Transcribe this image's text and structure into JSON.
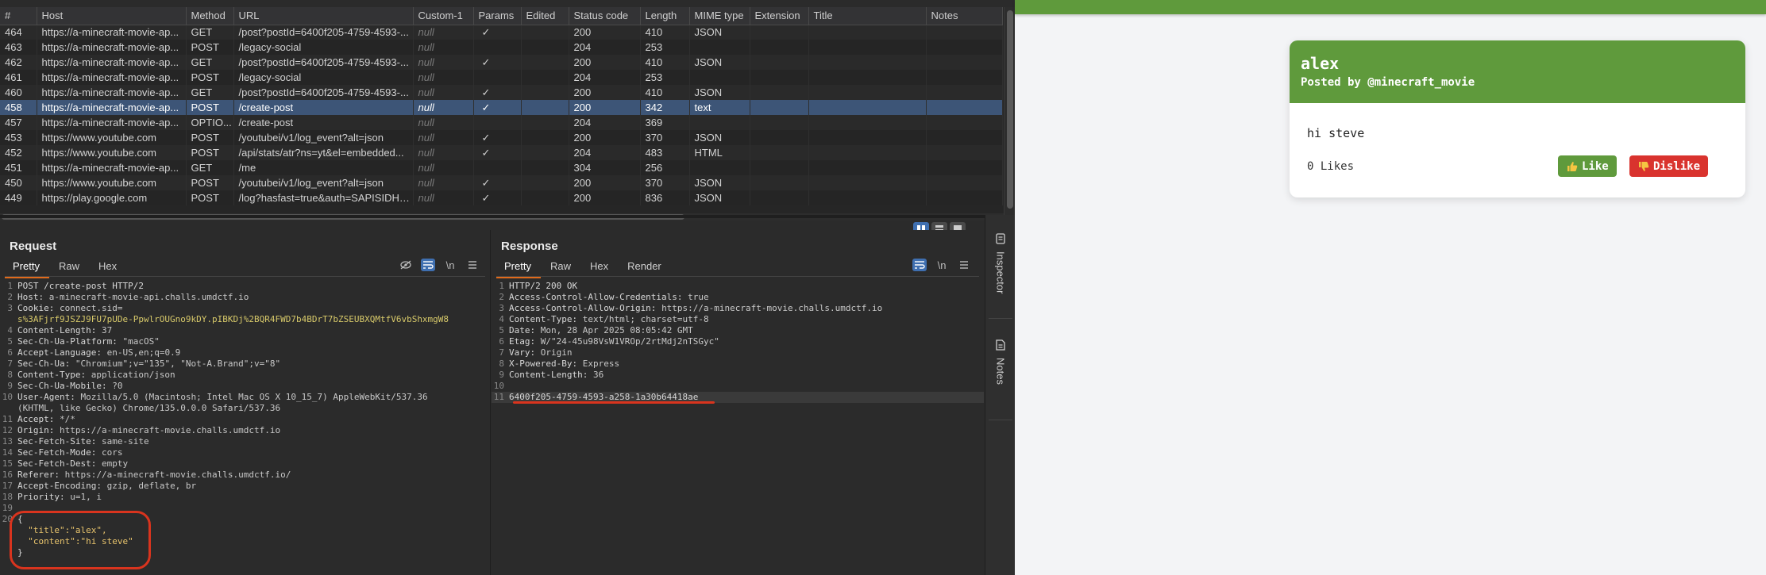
{
  "history": {
    "columns": [
      "#",
      "Host",
      "Method",
      "URL",
      "Custom-1",
      "Params",
      "Edited",
      "Status code",
      "Length",
      "MIME type",
      "Extension",
      "Title",
      "Notes"
    ],
    "rows": [
      {
        "id": "464",
        "host": "https://a-minecraft-movie-ap...",
        "method": "GET",
        "url": "/post?postId=6400f205-4759-4593-...",
        "custom": "null",
        "params": "✓",
        "status": "200",
        "length": "410",
        "mime": "JSON",
        "selected": false
      },
      {
        "id": "463",
        "host": "https://a-minecraft-movie-ap...",
        "method": "POST",
        "url": "/legacy-social",
        "custom": "null",
        "params": "",
        "status": "204",
        "length": "253",
        "mime": "",
        "selected": false
      },
      {
        "id": "462",
        "host": "https://a-minecraft-movie-ap...",
        "method": "GET",
        "url": "/post?postId=6400f205-4759-4593-...",
        "custom": "null",
        "params": "✓",
        "status": "200",
        "length": "410",
        "mime": "JSON",
        "selected": false
      },
      {
        "id": "461",
        "host": "https://a-minecraft-movie-ap...",
        "method": "POST",
        "url": "/legacy-social",
        "custom": "null",
        "params": "",
        "status": "204",
        "length": "253",
        "mime": "",
        "selected": false
      },
      {
        "id": "460",
        "host": "https://a-minecraft-movie-ap...",
        "method": "GET",
        "url": "/post?postId=6400f205-4759-4593-...",
        "custom": "null",
        "params": "✓",
        "status": "200",
        "length": "410",
        "mime": "JSON",
        "selected": false
      },
      {
        "id": "458",
        "host": "https://a-minecraft-movie-ap...",
        "method": "POST",
        "url": "/create-post",
        "custom": "null",
        "params": "✓",
        "status": "200",
        "length": "342",
        "mime": "text",
        "selected": true
      },
      {
        "id": "457",
        "host": "https://a-minecraft-movie-ap...",
        "method": "OPTIO...",
        "url": "/create-post",
        "custom": "null",
        "params": "",
        "status": "204",
        "length": "369",
        "mime": "",
        "selected": false
      },
      {
        "id": "453",
        "host": "https://www.youtube.com",
        "method": "POST",
        "url": "/youtubei/v1/log_event?alt=json",
        "custom": "null",
        "params": "✓",
        "status": "200",
        "length": "370",
        "mime": "JSON",
        "selected": false
      },
      {
        "id": "452",
        "host": "https://www.youtube.com",
        "method": "POST",
        "url": "/api/stats/atr?ns=yt&el=embedded...",
        "custom": "null",
        "params": "✓",
        "status": "204",
        "length": "483",
        "mime": "HTML",
        "selected": false
      },
      {
        "id": "451",
        "host": "https://a-minecraft-movie-ap...",
        "method": "GET",
        "url": "/me",
        "custom": "null",
        "params": "",
        "status": "304",
        "length": "256",
        "mime": "",
        "selected": false
      },
      {
        "id": "450",
        "host": "https://www.youtube.com",
        "method": "POST",
        "url": "/youtubei/v1/log_event?alt=json",
        "custom": "null",
        "params": "✓",
        "status": "200",
        "length": "370",
        "mime": "JSON",
        "selected": false
      },
      {
        "id": "449",
        "host": "https://play.google.com",
        "method": "POST",
        "url": "/log?hasfast=true&auth=SAPISIDHA...",
        "custom": "null",
        "params": "✓",
        "status": "200",
        "length": "836",
        "mime": "JSON",
        "selected": false
      }
    ]
  },
  "request": {
    "title": "Request",
    "tabs": [
      "Pretty",
      "Raw",
      "Hex"
    ],
    "newline_label": "\\n",
    "lines": [
      {
        "n": "1",
        "k": "POST /create-post HTTP/2",
        "v": ""
      },
      {
        "n": "2",
        "k": "Host: ",
        "v": "a-minecraft-movie-api.challs.umdctf.io"
      },
      {
        "n": "3",
        "k": "Cookie: ",
        "v": "connect.sid="
      },
      {
        "n": "",
        "k": "",
        "v": "s%3AFjrf9JSZJ9FU7pUDe-PpwlrOUGno9kDY.pIBKDj%2BQR4FWD7b4BDrT7bZSEUBXQMtfV6vbShxmgW8",
        "cookie": true
      },
      {
        "n": "4",
        "k": "Content-Length: ",
        "v": "37"
      },
      {
        "n": "5",
        "k": "Sec-Ch-Ua-Platform: ",
        "v": "\"macOS\""
      },
      {
        "n": "6",
        "k": "Accept-Language: ",
        "v": "en-US,en;q=0.9"
      },
      {
        "n": "7",
        "k": "Sec-Ch-Ua: ",
        "v": "\"Chromium\";v=\"135\", \"Not-A.Brand\";v=\"8\""
      },
      {
        "n": "8",
        "k": "Content-Type: ",
        "v": "application/json"
      },
      {
        "n": "9",
        "k": "Sec-Ch-Ua-Mobile: ",
        "v": "?0"
      },
      {
        "n": "10",
        "k": "User-Agent: ",
        "v": "Mozilla/5.0 (Macintosh; Intel Mac OS X 10_15_7) AppleWebKit/537.36"
      },
      {
        "n": "",
        "k": "",
        "v": "(KHTML, like Gecko) Chrome/135.0.0.0 Safari/537.36"
      },
      {
        "n": "11",
        "k": "Accept: ",
        "v": "*/*"
      },
      {
        "n": "12",
        "k": "Origin: ",
        "v": "https://a-minecraft-movie.challs.umdctf.io"
      },
      {
        "n": "13",
        "k": "Sec-Fetch-Site: ",
        "v": "same-site"
      },
      {
        "n": "14",
        "k": "Sec-Fetch-Mode: ",
        "v": "cors"
      },
      {
        "n": "15",
        "k": "Sec-Fetch-Dest: ",
        "v": "empty"
      },
      {
        "n": "16",
        "k": "Referer: ",
        "v": "https://a-minecraft-movie.challs.umdctf.io/"
      },
      {
        "n": "17",
        "k": "Accept-Encoding: ",
        "v": "gzip, deflate, br"
      },
      {
        "n": "18",
        "k": "Priority: ",
        "v": "u=1, i"
      },
      {
        "n": "19",
        "k": "",
        "v": ""
      },
      {
        "n": "20",
        "k": "{",
        "v": ""
      },
      {
        "n": "",
        "k": "  ",
        "v": "\"title\":\"alex\",",
        "json": true
      },
      {
        "n": "",
        "k": "  ",
        "v": "\"content\":\"hi steve\"",
        "json": true
      },
      {
        "n": "",
        "k": "}",
        "v": ""
      }
    ]
  },
  "response": {
    "title": "Response",
    "tabs": [
      "Pretty",
      "Raw",
      "Hex",
      "Render"
    ],
    "newline_label": "\\n",
    "lines": [
      {
        "n": "1",
        "k": "HTTP/2 200 OK",
        "v": ""
      },
      {
        "n": "2",
        "k": "Access-Control-Allow-Credentials: ",
        "v": "true"
      },
      {
        "n": "3",
        "k": "Access-Control-Allow-Origin: ",
        "v": "https://a-minecraft-movie.challs.umdctf.io"
      },
      {
        "n": "4",
        "k": "Content-Type: ",
        "v": "text/html; charset=utf-8"
      },
      {
        "n": "5",
        "k": "Date: ",
        "v": "Mon, 28 Apr 2025 08:05:42 GMT"
      },
      {
        "n": "6",
        "k": "Etag: ",
        "v": "W/\"24-45u98VsW1VROp/2rtMdj2nTSGyc\""
      },
      {
        "n": "7",
        "k": "Vary: ",
        "v": "Origin"
      },
      {
        "n": "8",
        "k": "X-Powered-By: ",
        "v": "Express"
      },
      {
        "n": "9",
        "k": "Content-Length: ",
        "v": "36"
      },
      {
        "n": "10",
        "k": "",
        "v": ""
      },
      {
        "n": "11",
        "k": "6400f205-4759-4593-a258-1a30b64418ae",
        "v": "",
        "highlight": true
      }
    ]
  },
  "sidebar": {
    "inspector_label": "Inspector",
    "notes_label": "Notes"
  },
  "post": {
    "title": "alex",
    "author": "Posted by @minecraft_movie",
    "content": "hi steve",
    "likes": "0 Likes",
    "like_label": "Like",
    "dislike_label": "Dislike"
  },
  "colors": {
    "accent_green": "#5f9a3c",
    "dislike_red": "#d9332e",
    "annotation_red": "#d9341e",
    "selected_row": "#3d5577"
  }
}
